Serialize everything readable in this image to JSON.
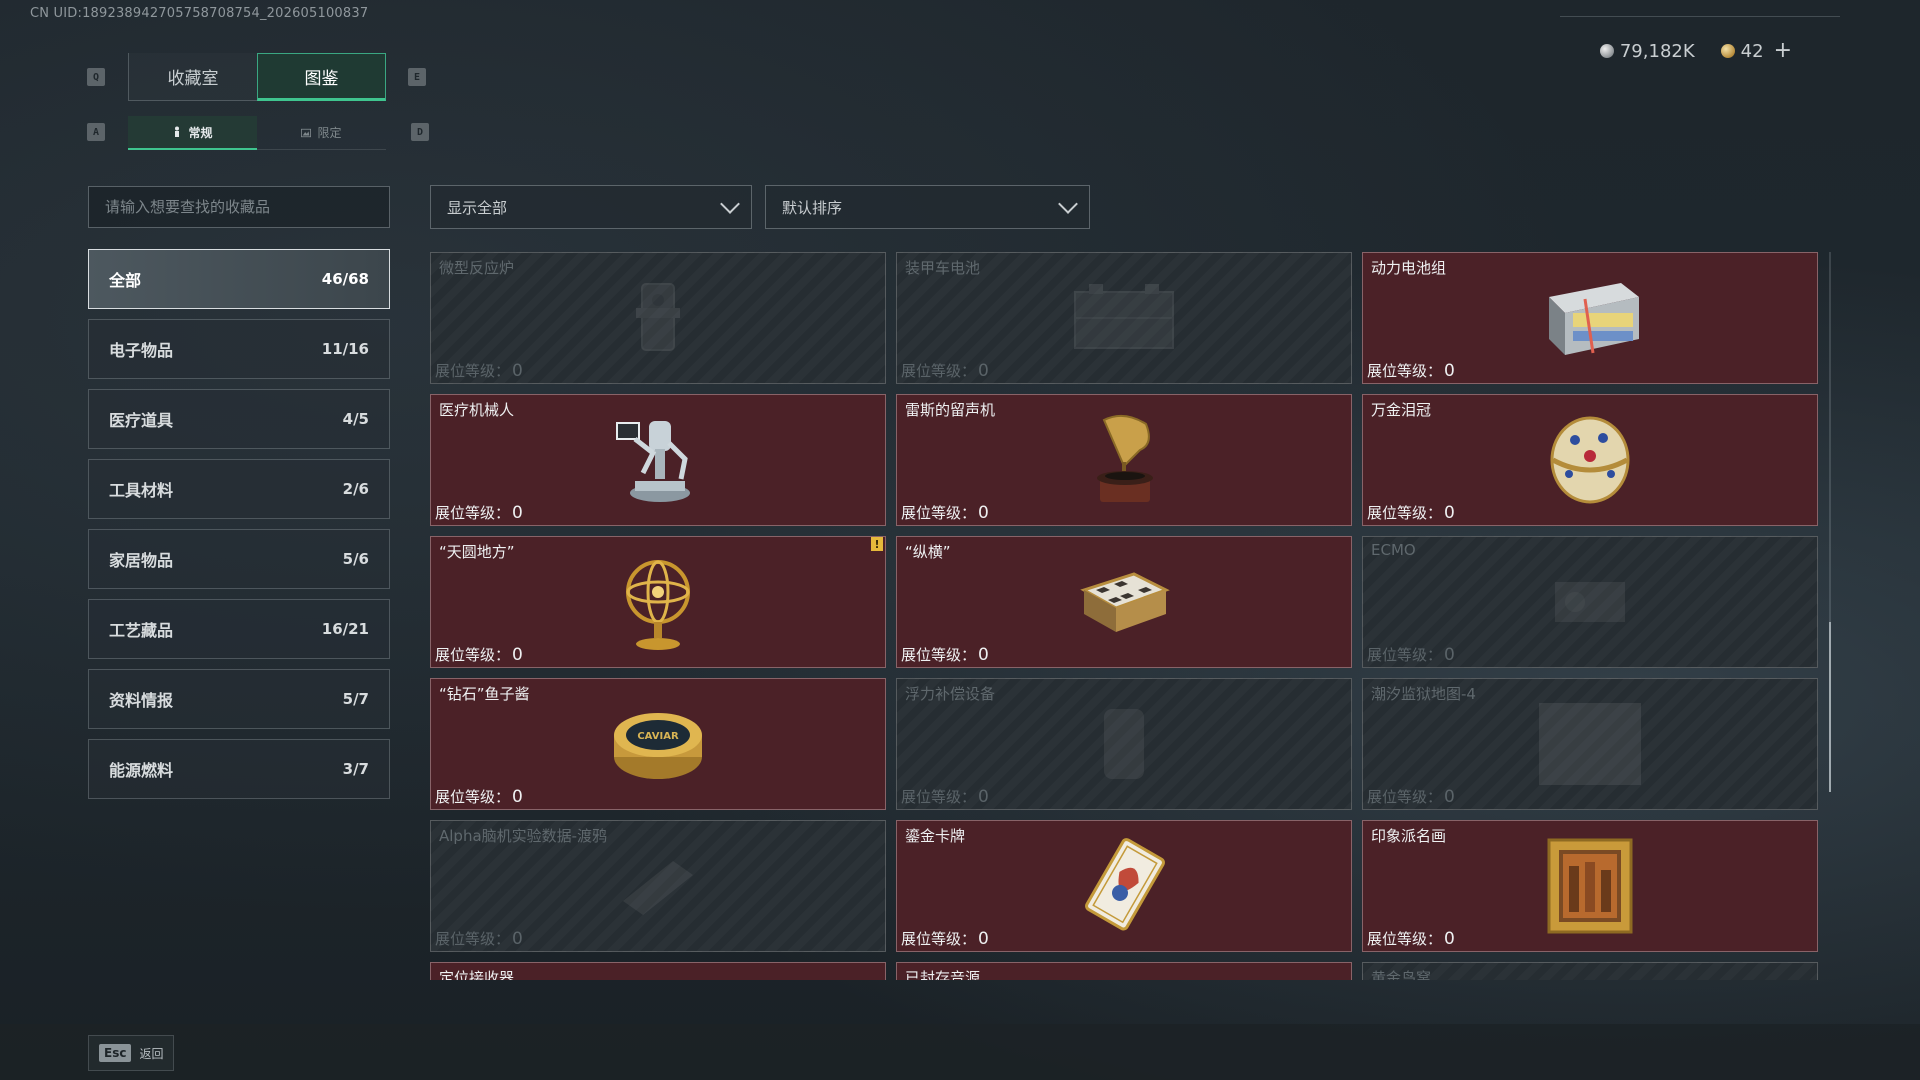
{
  "uid_text": "CN UID:1892389427057587087​54_202605100837",
  "currency": {
    "silver": "79,182K",
    "gold": "42",
    "plus": "+"
  },
  "hotkeys": {
    "prev_tab": "Q",
    "next_tab": "E",
    "prev_sub": "A",
    "next_sub": "D"
  },
  "main_tabs": [
    {
      "label": "收藏室",
      "active": false
    },
    {
      "label": "图鉴",
      "active": true
    }
  ],
  "sub_tabs": [
    {
      "label": "常规",
      "icon": "figure-icon",
      "active": true
    },
    {
      "label": "限定",
      "icon": "image-icon",
      "active": false
    }
  ],
  "search": {
    "placeholder": "请输入想要查找的收藏品"
  },
  "filters": {
    "show": "显示全部",
    "sort": "默认排序"
  },
  "categories": [
    {
      "label": "全部",
      "count": "46/68",
      "active": true
    },
    {
      "label": "电子物品",
      "count": "11/16"
    },
    {
      "label": "医疗道具",
      "count": "4/5"
    },
    {
      "label": "工具材料",
      "count": "2/6"
    },
    {
      "label": "家居物品",
      "count": "5/6"
    },
    {
      "label": "工艺藏品",
      "count": "16/21"
    },
    {
      "label": "资料情报",
      "count": "5/7"
    },
    {
      "label": "能源燃料",
      "count": "3/7"
    }
  ],
  "level_label": "展位等级：",
  "items": [
    {
      "name": "微型反应炉",
      "level": "0",
      "owned": false,
      "icon": "reactor-icon"
    },
    {
      "name": "装甲车电池",
      "level": "0",
      "owned": false,
      "icon": "battery-box-icon"
    },
    {
      "name": "动力电池组",
      "level": "0",
      "owned": true,
      "icon": "battery-pack-icon"
    },
    {
      "name": "医疗机械人",
      "level": "0",
      "owned": true,
      "icon": "medical-robot-icon"
    },
    {
      "name": "雷斯的留声机",
      "level": "0",
      "owned": true,
      "icon": "gramophone-icon"
    },
    {
      "name": "万金泪冠",
      "level": "0",
      "owned": true,
      "icon": "jeweled-egg-icon"
    },
    {
      "name": "“天圆地方”",
      "level": "0",
      "owned": true,
      "icon": "armillary-sphere-icon",
      "new": "!"
    },
    {
      "name": "“纵横”",
      "level": "0",
      "owned": true,
      "icon": "chess-box-icon"
    },
    {
      "name": "ECMO",
      "level": "0",
      "owned": false,
      "icon": "ecmo-icon"
    },
    {
      "name": "“钻石”鱼子酱",
      "level": "0",
      "owned": true,
      "icon": "caviar-tin-icon",
      "art_text": "CAVIAR"
    },
    {
      "name": "浮力补偿设备",
      "level": "0",
      "owned": false,
      "icon": "bcd-icon"
    },
    {
      "name": "潮汐监狱地图-4",
      "level": "0",
      "owned": false,
      "icon": "map-icon"
    },
    {
      "name": "Alpha脑机实验数据-渡鸦",
      "level": "0",
      "owned": false,
      "icon": "data-drive-icon"
    },
    {
      "name": "鎏金卡牌",
      "level": "0",
      "owned": true,
      "icon": "gilded-card-icon"
    },
    {
      "name": "印象派名画",
      "level": "0",
      "owned": true,
      "icon": "painting-icon"
    },
    {
      "name": "定位接收器",
      "level": "",
      "owned": true,
      "icon": "receiver-icon"
    },
    {
      "name": "已封存音源",
      "level": "",
      "owned": true,
      "icon": "sealed-audio-icon"
    },
    {
      "name": "黄金鸟窝",
      "level": "",
      "owned": false,
      "icon": "nest-icon"
    }
  ],
  "footer": {
    "esc_key": "Esc",
    "esc_label": "返回"
  }
}
